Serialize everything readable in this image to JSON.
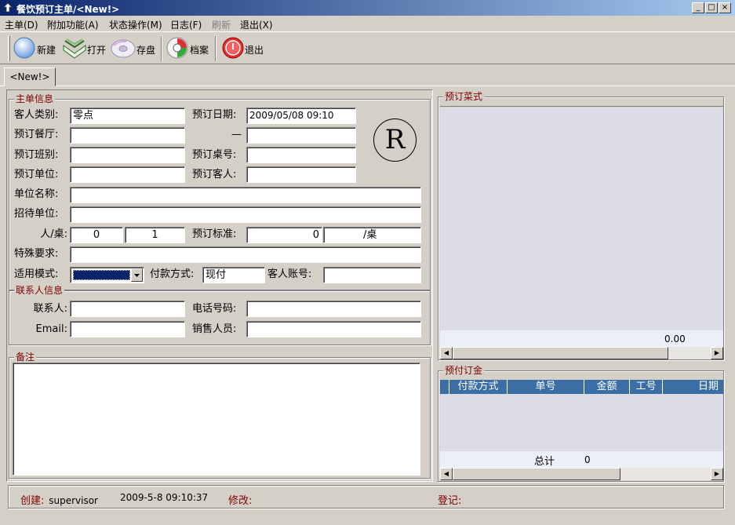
{
  "window": {
    "title": "餐饮预订主单/<New!>",
    "min_glyph": "_",
    "max_glyph": "□",
    "close_glyph": "×"
  },
  "menu": [
    {
      "label": "主单(D)",
      "disabled": false
    },
    {
      "label": "附加功能(A)",
      "disabled": false
    },
    {
      "label": "状态操作(M)",
      "disabled": false
    },
    {
      "label": "日志(F)",
      "disabled": false
    },
    {
      "label": "刷新",
      "disabled": true
    },
    {
      "label": "退出(X)",
      "disabled": false
    }
  ],
  "toolbar": {
    "new_label": "新建",
    "open_label": "打开",
    "save_label": "存盘",
    "archive_label": "档案",
    "exit_label": "退出",
    "icons": {
      "new": "new-doc-icon",
      "open": "open-book-icon",
      "save": "save-disk-icon",
      "archive": "archive-icon",
      "exit": "exit-power-icon"
    }
  },
  "tab": {
    "label": "<New!>"
  },
  "main_info": {
    "group_title": "主单信息",
    "customer_type_label": "客人类别:",
    "customer_type_value": "零点",
    "booking_date_label": "预订日期:",
    "booking_date_value": "2009/05/08 09:10",
    "restaurant_label": "预订餐厅:",
    "restaurant_value": "",
    "dash": "—",
    "date_to_value": "",
    "shift_label": "预订班别:",
    "shift_value": "",
    "table_no_label": "预订桌号:",
    "table_no_value": "",
    "unit_label": "预订单位:",
    "unit_value": "",
    "guest_label": "预订客人:",
    "guest_value": "",
    "unit_name_label": "单位名称:",
    "unit_name_value": "",
    "host_unit_label": "招待单位:",
    "host_unit_value": "",
    "per_table_label": "人/桌:",
    "persons_value": "0",
    "tables_value": "1",
    "standard_label": "预订标准:",
    "standard_value": "0",
    "standard_unit": "/桌",
    "special_label": "特殊要求:",
    "special_value": "",
    "mode_label": "适用模式:",
    "mode_value": "",
    "payment_label": "付款方式:",
    "payment_value": "现付",
    "account_label": "客人账号:",
    "account_value": "",
    "stamp": "R"
  },
  "contact": {
    "group_title": "联系人信息",
    "contact_label": "联系人:",
    "contact_value": "",
    "phone_label": "电话号码:",
    "phone_value": "",
    "email_label": "Email:",
    "email_value": "",
    "sales_label": "销售人员:",
    "sales_value": ""
  },
  "remarks": {
    "group_title": "备注",
    "value": ""
  },
  "menu_panel": {
    "group_title": "预订菜式",
    "total": "0.00"
  },
  "deposit": {
    "group_title": "预付订金",
    "columns": [
      "付款方式",
      "单号",
      "金额",
      "工号",
      "日期"
    ],
    "total_label": "总计",
    "total_value": "0"
  },
  "status": {
    "created_label": "创建:",
    "created_user": "supervisor",
    "created_time": "2009-5-8 09:10:37",
    "modified_label": "修改:",
    "registered_label": "登记:"
  },
  "colors": {
    "title_start": "#0a246a",
    "title_end": "#a6caf0",
    "accent": "#800000",
    "grid_header": "#3a6ea5",
    "panel_bg": "#dcdce6"
  }
}
